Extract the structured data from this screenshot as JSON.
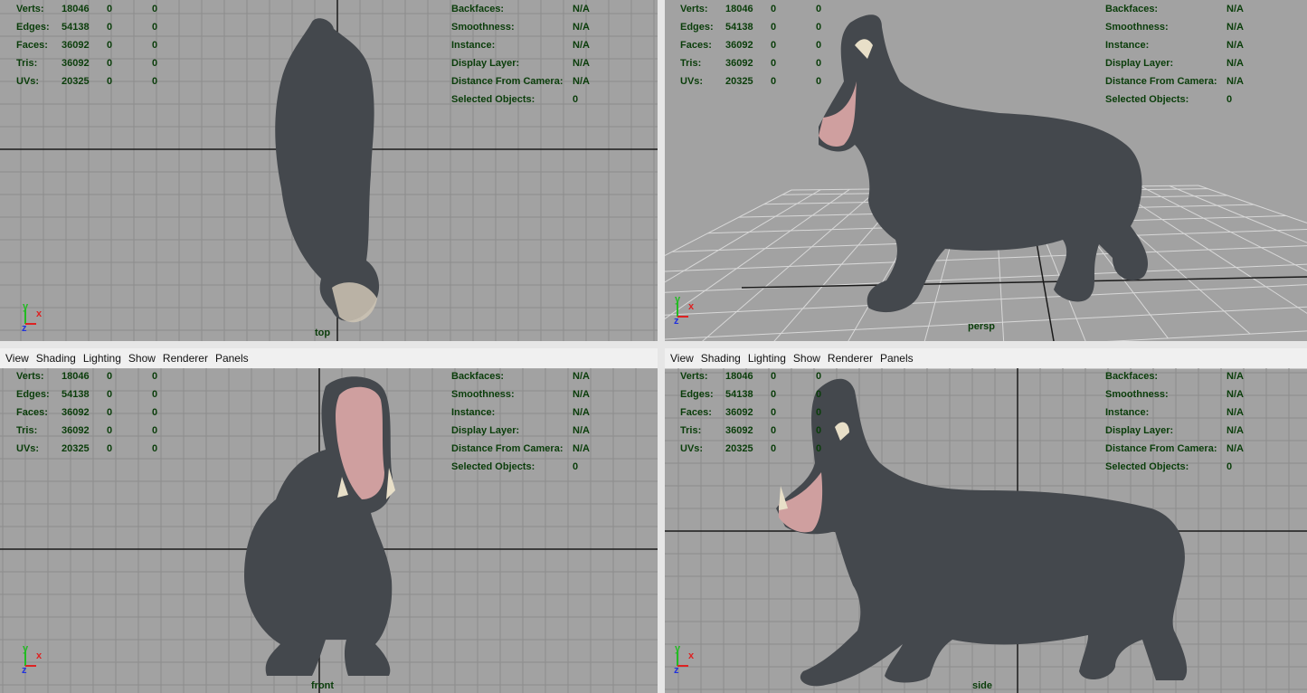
{
  "menu": [
    "View",
    "Shading",
    "Lighting",
    "Show",
    "Renderer",
    "Panels"
  ],
  "stats": {
    "labels": [
      "Verts:",
      "Edges:",
      "Faces:",
      "Tris:",
      "UVs:"
    ],
    "values": [
      "18046",
      "54138",
      "36092",
      "36092",
      "20325"
    ],
    "sel": "0",
    "comp": "0"
  },
  "info": {
    "labels": [
      "Backfaces:",
      "Smoothness:",
      "Instance:",
      "Display Layer:",
      "Distance From Camera:",
      "Selected Objects:"
    ],
    "values": [
      "N/A",
      "N/A",
      "N/A",
      "N/A",
      "N/A",
      "0"
    ]
  },
  "cameras": {
    "top": "top",
    "persp": "persp",
    "front": "front",
    "side": "side"
  },
  "axis_labels": {
    "x": "x",
    "y": "y",
    "z": "z"
  },
  "colors": {
    "viewport_bg": "#a2a2a2",
    "grid": "#8c8c8c",
    "hud_text": "#0a3d0a",
    "model": "#44484d"
  }
}
